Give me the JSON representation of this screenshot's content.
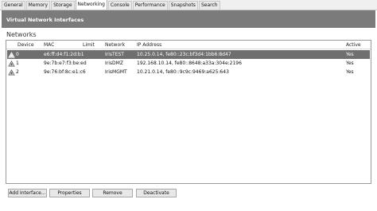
{
  "tabs": [
    {
      "label": "General",
      "active": false
    },
    {
      "label": "Memory",
      "active": false
    },
    {
      "label": "Storage",
      "active": false
    },
    {
      "label": "Networking",
      "active": true
    },
    {
      "label": "Console",
      "active": false
    },
    {
      "label": "Performance",
      "active": false
    },
    {
      "label": "Snapshots",
      "active": false
    },
    {
      "label": "Search",
      "active": false
    }
  ],
  "header": {
    "title": "Virtual Network Interfaces"
  },
  "networks": {
    "section_title": "Networks",
    "columns": [
      "Device",
      "MAC",
      "Limit",
      "Network",
      "IP Address",
      "Active"
    ],
    "rows": [
      {
        "device": "0",
        "mac": "e6:ff:d4:f1:2d:b1",
        "limit": "",
        "network": "IrisTEST",
        "ip": "10.25.0.14, fe80::23c:bf3d4:1bb6:8d47",
        "active": "Yes",
        "selected": true
      },
      {
        "device": "1",
        "mac": "9e:7b:e7:f3:be:ed",
        "limit": "",
        "network": "IrisDMZ",
        "ip": "192.168.10.14, fe80::8648:a33a:304e:2196",
        "active": "Yes",
        "selected": false
      },
      {
        "device": "2",
        "mac": "9e:76:bf:8c:e1:c6",
        "limit": "",
        "network": "IrisMGMT",
        "ip": "10.21.0.14, fe80::9c9c:9469:a625:643",
        "active": "Yes",
        "selected": false
      }
    ]
  },
  "buttons": {
    "add": "Add Interface...",
    "properties": "Properties",
    "remove": "Remove",
    "deactivate": "Deactivate"
  },
  "icons": {
    "device": "network-adapter-icon"
  },
  "colors": {
    "header_bg": "#7b7b7b",
    "selected_row": "#6f6f6f"
  }
}
